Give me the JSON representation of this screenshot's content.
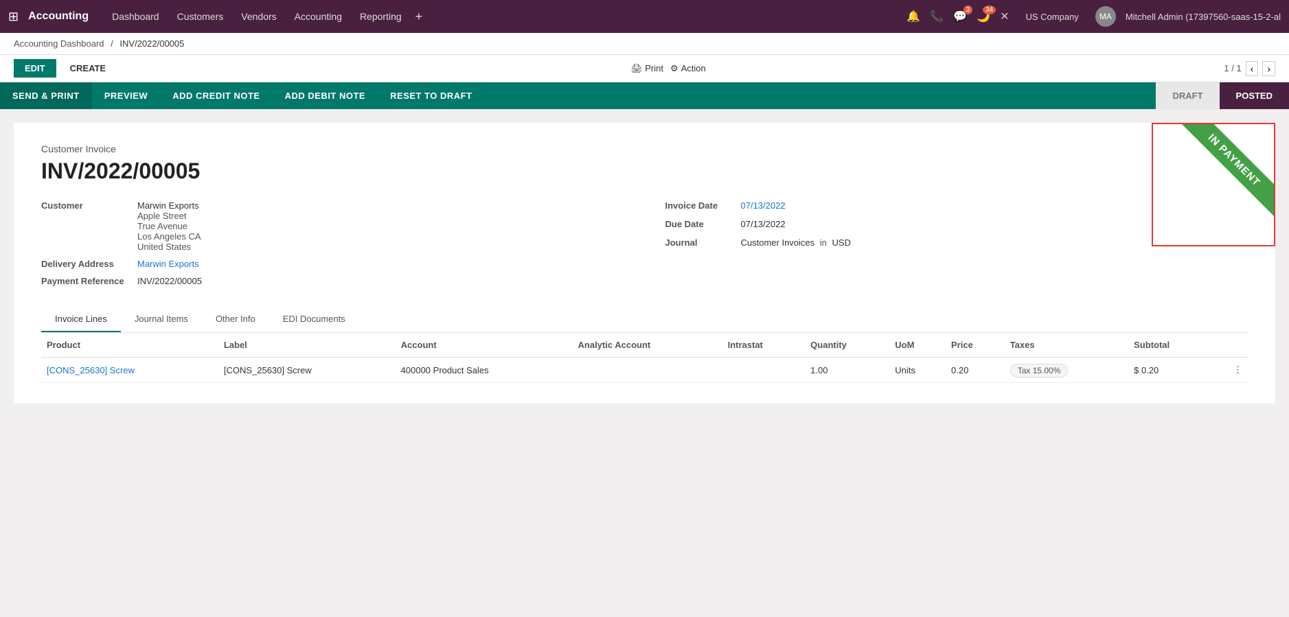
{
  "topnav": {
    "app_grid_icon": "⊞",
    "app_name": "Accounting",
    "nav_links": [
      "Dashboard",
      "Customers",
      "Vendors",
      "Accounting",
      "Reporting"
    ],
    "plus_label": "+",
    "icons": {
      "bell": "🔔",
      "phone": "📞",
      "chat": "💬",
      "chat_badge": "3",
      "moon": "🌙",
      "moon_badge": "34",
      "close": "✕"
    },
    "company": "US Company",
    "user_initials": "MA",
    "user_name": "Mitchell Admin (17397560-saas-15-2-al"
  },
  "breadcrumb": {
    "parent": "Accounting Dashboard",
    "separator": "/",
    "current": "INV/2022/00005"
  },
  "toolbar": {
    "edit_label": "EDIT",
    "create_label": "CREATE",
    "print_label": "Print",
    "print_icon": "🖨",
    "action_label": "Action",
    "action_icon": "⚙",
    "pager": "1 / 1",
    "prev_icon": "‹",
    "next_icon": "›"
  },
  "action_bar": {
    "buttons": [
      {
        "label": "SEND & PRINT",
        "primary": true
      },
      {
        "label": "PREVIEW",
        "primary": false
      },
      {
        "label": "ADD CREDIT NOTE",
        "primary": false
      },
      {
        "label": "ADD DEBIT NOTE",
        "primary": false
      },
      {
        "label": "RESET TO DRAFT",
        "primary": false
      }
    ],
    "status_pills": [
      {
        "label": "DRAFT",
        "active": false
      },
      {
        "label": "POSTED",
        "active": true
      }
    ]
  },
  "invoice": {
    "type": "Customer Invoice",
    "number": "INV/2022/00005",
    "customer_label": "Customer",
    "customer_name": "Marwin Exports",
    "customer_address": [
      "Apple Street",
      "True Avenue",
      "Los Angeles CA",
      "United States"
    ],
    "delivery_address_label": "Delivery Address",
    "delivery_address": "Marwin Exports",
    "payment_reference_label": "Payment Reference",
    "payment_reference": "INV/2022/00005",
    "invoice_date_label": "Invoice Date",
    "invoice_date": "07/13/2022",
    "due_date_label": "Due Date",
    "due_date": "07/13/2022",
    "journal_label": "Journal",
    "journal_name": "Customer Invoices",
    "journal_in": "in",
    "journal_currency": "USD",
    "ribbon_text": "IN PAYMENT"
  },
  "tabs": [
    {
      "label": "Invoice Lines",
      "active": true
    },
    {
      "label": "Journal Items",
      "active": false
    },
    {
      "label": "Other Info",
      "active": false
    },
    {
      "label": "EDI Documents",
      "active": false
    }
  ],
  "table": {
    "columns": [
      "Product",
      "Label",
      "Account",
      "Analytic Account",
      "Intrastat",
      "Quantity",
      "UoM",
      "Price",
      "Taxes",
      "Subtotal"
    ],
    "rows": [
      {
        "product": "[CONS_25630] Screw",
        "label": "[CONS_25630] Screw",
        "account": "400000 Product Sales",
        "analytic_account": "",
        "intrastat": "",
        "quantity": "1.00",
        "uom": "Units",
        "price": "0.20",
        "taxes": "Tax 15.00%",
        "subtotal": "$ 0.20"
      }
    ]
  }
}
